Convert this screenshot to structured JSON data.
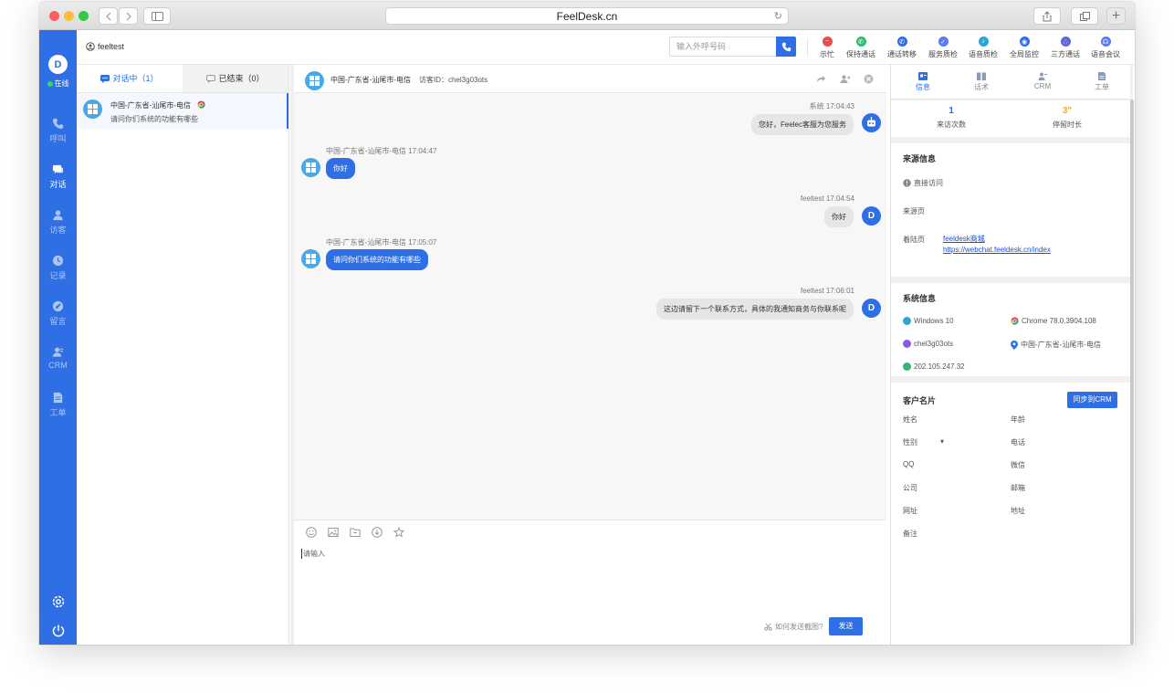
{
  "browser": {
    "url": "FeelDesk.cn",
    "tab_add": "+",
    "colors": {
      "close": "#fc605c",
      "minimize": "#fdbc40",
      "zoom": "#34c84a"
    }
  },
  "app": {
    "brand_color": "#2e6fe6",
    "status": "在线",
    "logo_text": "D",
    "nav": [
      {
        "label": "呼叫",
        "icon": "phone-icon"
      },
      {
        "label": "对话",
        "icon": "chat-icon",
        "active": true
      },
      {
        "label": "访客",
        "icon": "visitor-icon"
      },
      {
        "label": "记录",
        "icon": "clock-icon"
      },
      {
        "label": "留言",
        "icon": "message-icon"
      },
      {
        "label": "CRM",
        "icon": "crm-icon"
      },
      {
        "label": "工单",
        "icon": "ticket-icon"
      }
    ]
  },
  "header": {
    "username": "feeltest",
    "dial_placeholder": "输入外呼号码",
    "tools": [
      {
        "label": "示忙",
        "color": "#e84c4c",
        "icon": "busy-icon"
      },
      {
        "label": "保持通话",
        "color": "#2ebd6b",
        "icon": "hold-call-icon"
      },
      {
        "label": "通话转移",
        "color": "#2e6fe6",
        "icon": "transfer-call-icon"
      },
      {
        "label": "服务质检",
        "color": "#5b7cf0",
        "icon": "quality-check-icon"
      },
      {
        "label": "语音质检",
        "color": "#2aa6d6",
        "icon": "voice-check-icon"
      },
      {
        "label": "全局监控",
        "color": "#2e6fe6",
        "icon": "monitor-icon"
      },
      {
        "label": "三方通话",
        "color": "#5b6cd6",
        "icon": "three-way-call-icon"
      },
      {
        "label": "语音会议",
        "color": "#5b7cf0",
        "icon": "conference-icon"
      }
    ]
  },
  "convlist": {
    "tab_active": "对话中（1）",
    "tab_ended": "已结束（0）",
    "items": [
      {
        "name": "中国-广东省-汕尾市-电信",
        "last_message": "请问你们系统的功能有哪些"
      }
    ]
  },
  "chat": {
    "title": "中国-广东省-汕尾市-电信",
    "visitor_id": "访客ID：chel3g03ots",
    "messages": [
      {
        "side": "out",
        "meta": "系统 17:04:43",
        "text": "您好，Feelec客服为您服务",
        "avatar": "robot"
      },
      {
        "side": "in",
        "meta": "中国-广东省-汕尾市-电信 17:04:47",
        "text": "你好"
      },
      {
        "side": "out",
        "meta": "feeltest 17:04:54",
        "text": "你好",
        "avatar": "agent"
      },
      {
        "side": "in",
        "meta": "中国-广东省-汕尾市-电信 17:05:07",
        "text": "请问你们系统的功能有哪些"
      },
      {
        "side": "out",
        "meta": "feeltest 17:06:01",
        "text": "这边请留下一个联系方式，具体的我通知商务与你联系呢",
        "avatar": "agent"
      }
    ],
    "input_placeholder": "请输入",
    "howto": "如何发送截图?",
    "send": "发送"
  },
  "right": {
    "tabs": [
      {
        "label": "信息",
        "active": true
      },
      {
        "label": "话术"
      },
      {
        "label": "CRM"
      },
      {
        "label": "工单"
      }
    ],
    "stats": [
      {
        "value": "1",
        "label": "来访次数"
      },
      {
        "value": "3\"",
        "label": "停留时长"
      }
    ],
    "source": {
      "title": "来源信息",
      "access": "直接访问",
      "from_label": "来源页",
      "landing_label": "着陆页",
      "landing_name": "feeldesk商城",
      "landing_url": "https://webchat.feeldesk.cn/index"
    },
    "system": {
      "title": "系统信息",
      "os": "Windows 10",
      "browser": "Chrome 78.0.3904.108",
      "id": "chel3g03ots",
      "location": "中国-广东省-汕尾市-电信",
      "ip": "202.105.247.32"
    },
    "card": {
      "title": "客户名片",
      "sync": "同步到CRM",
      "fields": [
        "姓名",
        "年龄",
        "性别",
        "电话",
        "QQ",
        "微信",
        "公司",
        "邮箱",
        "网址",
        "地址",
        "备注"
      ],
      "gender_caret": "▾"
    }
  }
}
